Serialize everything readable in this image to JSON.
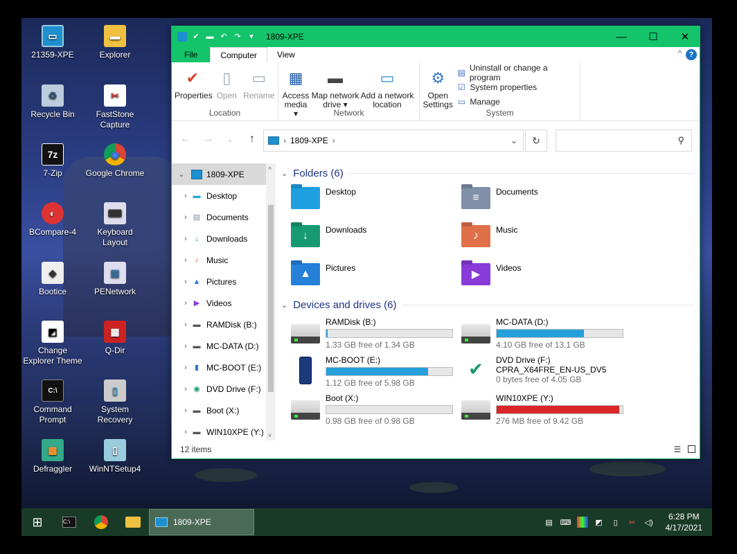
{
  "desktop": {
    "icons": [
      {
        "label": "21359-XPE",
        "glyph": "▭",
        "icon": "computer-icon"
      },
      {
        "label": "Explorer",
        "glyph": "▬",
        "icon": "folder-icon"
      },
      {
        "label": "Recycle Bin",
        "glyph": "♻",
        "icon": "recycle-bin-icon"
      },
      {
        "label": "FastStone Capture",
        "glyph": "✂",
        "icon": "faststone-icon"
      },
      {
        "label": "7-Zip",
        "glyph": "7z",
        "icon": "7zip-icon"
      },
      {
        "label": "Google Chrome",
        "glyph": "◉",
        "icon": "chrome-icon"
      },
      {
        "label": "BCompare-4",
        "glyph": "◐",
        "icon": "bcompare-icon"
      },
      {
        "label": "Keyboard Layout",
        "glyph": "⌨",
        "icon": "keyboard-icon"
      },
      {
        "label": "Bootice",
        "glyph": "◆",
        "icon": "bootice-icon"
      },
      {
        "label": "PENetwork",
        "glyph": "▤",
        "icon": "penetwork-icon"
      },
      {
        "label": "Change Explorer Theme",
        "glyph": "◩",
        "icon": "theme-icon"
      },
      {
        "label": "Q-Dir",
        "glyph": "▦",
        "icon": "qdir-icon"
      },
      {
        "label": "Command Prompt",
        "glyph": "C:\\",
        "icon": "cmd-icon"
      },
      {
        "label": "System Recovery",
        "glyph": "▯",
        "icon": "recovery-icon"
      },
      {
        "label": "Defraggler",
        "glyph": "▩",
        "icon": "defraggler-icon"
      },
      {
        "label": "WinNTSetup4",
        "glyph": "▯",
        "icon": "winntsetup-icon"
      }
    ]
  },
  "window": {
    "title": "1809-XPE",
    "controls": {
      "minimize": "—",
      "maximize": "☐",
      "close": "✕"
    }
  },
  "ribbon": {
    "tabs": {
      "file": "File",
      "computer": "Computer",
      "view": "View"
    },
    "help": "?",
    "location": {
      "label": "Location",
      "properties": "Properties",
      "open": "Open",
      "rename": "Rename"
    },
    "network": {
      "label": "Network",
      "access_media": "Access media ▾",
      "map_drive": "Map network drive ▾",
      "add_location": "Add a network location"
    },
    "system": {
      "label": "System",
      "open_settings": "Open Settings",
      "uninstall": "Uninstall or change a program",
      "system_properties": "System properties",
      "manage": "Manage"
    }
  },
  "address": {
    "path": "1809-XPE",
    "separator": "›"
  },
  "nav": {
    "root": "1809-XPE",
    "items": [
      {
        "label": "Desktop",
        "glyph": "▬",
        "color": "#29a8e0"
      },
      {
        "label": "Documents",
        "glyph": "▤",
        "color": "#7a8aa0"
      },
      {
        "label": "Downloads",
        "glyph": "↓",
        "color": "#1e9a6a"
      },
      {
        "label": "Music",
        "glyph": "♪",
        "color": "#e06a4a"
      },
      {
        "label": "Pictures",
        "glyph": "▲",
        "color": "#2a7ad8"
      },
      {
        "label": "Videos",
        "glyph": "▶",
        "color": "#8a3ad8"
      },
      {
        "label": "RAMDisk (B:)",
        "glyph": "▬",
        "color": "#555"
      },
      {
        "label": "MC-DATA (D:)",
        "glyph": "▬",
        "color": "#555"
      },
      {
        "label": "MC-BOOT (E:)",
        "glyph": "▮",
        "color": "#2a7ad8"
      },
      {
        "label": "DVD Drive (F:)",
        "glyph": "◉",
        "color": "#1e9a6a"
      },
      {
        "label": "Boot (X:)",
        "glyph": "▬",
        "color": "#555"
      },
      {
        "label": "WIN10XPE (Y:)",
        "glyph": "▬",
        "color": "#555"
      }
    ]
  },
  "content": {
    "folders_header": "Folders (6)",
    "drives_header": "Devices and drives (6)",
    "folders": [
      {
        "label": "Desktop",
        "color": "#1ea0e0",
        "glyph": ""
      },
      {
        "label": "Documents",
        "color": "#8090a8",
        "glyph": "≡"
      },
      {
        "label": "Downloads",
        "color": "#179a70",
        "glyph": "↓"
      },
      {
        "label": "Music",
        "color": "#e0704a",
        "glyph": "♪"
      },
      {
        "label": "Pictures",
        "color": "#2580d8",
        "glyph": "▲"
      },
      {
        "label": "Videos",
        "color": "#8a3ad8",
        "glyph": "▶"
      }
    ],
    "drives": [
      {
        "name": "RAMDisk (B:)",
        "sub": "",
        "free": "1.33 GB free of 1.34 GB",
        "used_fraction": 0.01,
        "red": false,
        "icon": "hdd"
      },
      {
        "name": "MC-DATA (D:)",
        "sub": "",
        "free": "4.10 GB free of 13.1 GB",
        "used_fraction": 0.69,
        "red": false,
        "icon": "hdd"
      },
      {
        "name": "MC-BOOT (E:)",
        "sub": "",
        "free": "1.12 GB free of 5.98 GB",
        "used_fraction": 0.81,
        "red": false,
        "icon": "usb"
      },
      {
        "name": "DVD Drive (F:)",
        "sub": "CPRA_X64FRE_EN-US_DV5",
        "free": "0 bytes free of 4.05 GB",
        "used_fraction": null,
        "red": false,
        "icon": "dvd"
      },
      {
        "name": "Boot (X:)",
        "sub": "",
        "free": "0.98 GB free of 0.98 GB",
        "used_fraction": 0.0,
        "red": false,
        "icon": "hdd"
      },
      {
        "name": "WIN10XPE (Y:)",
        "sub": "",
        "free": "276 MB free of 9.42 GB",
        "used_fraction": 0.97,
        "red": true,
        "icon": "hdd"
      }
    ]
  },
  "status": {
    "items": "12 items"
  },
  "taskbar": {
    "active_label": "1809-XPE",
    "time": "6:28 PM",
    "date": "4/17/2021"
  }
}
